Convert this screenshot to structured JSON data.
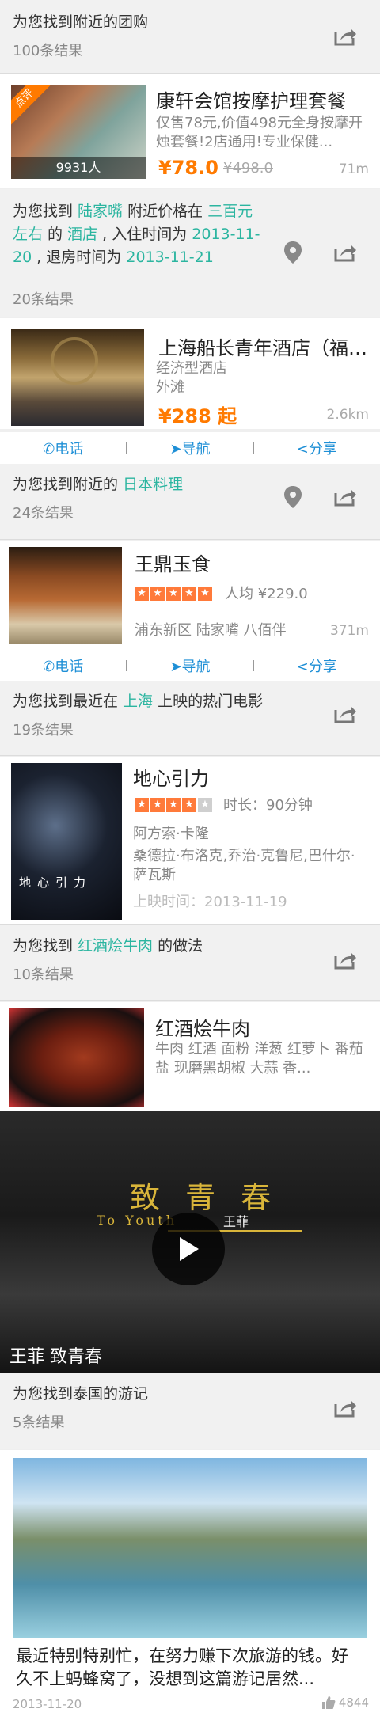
{
  "groupon_header": {
    "title": "为您找到附近的团购",
    "count": "100条结果"
  },
  "groupon_item": {
    "badge": "点评",
    "title": "康轩会馆按摩护理套餐",
    "desc": "仅售78元,价值498元全身按摩开烛套餐!2店通用!专业保健...",
    "price": "¥78.0",
    "old_price": "¥498.0",
    "distance": "71m",
    "people": "9931人"
  },
  "hotel_header": {
    "t1": "为您找到 ",
    "loc": "陆家嘴",
    "t2": " 附近价格在 ",
    "range": "三百元左右",
    "t3": " 的 ",
    "type": "酒店",
    "t4": " , 入住时间为 ",
    "checkin": "2013-11-20",
    "t5": " , 退房时间为 ",
    "checkout": "2013-11-21",
    "count": "20条结果"
  },
  "hotel_item": {
    "title": "上海船长青年酒店（福州路店）",
    "category": "经济型酒店",
    "area": "外滩",
    "price": "¥288 起",
    "distance": "2.6km"
  },
  "actions": {
    "call": "电话",
    "nav": "导航",
    "share": "分享"
  },
  "food_header": {
    "t1": "为您找到附近的 ",
    "cuisine": "日本料理",
    "count": "24条结果"
  },
  "food_item": {
    "title": "王鼎玉食",
    "avg": "人均 ¥229.0",
    "address": "浦东新区 陆家嘴 八佰伴",
    "distance": "371m",
    "rating": 5
  },
  "movie_header": {
    "t1": "为您找到最近在 ",
    "city": "上海",
    "t2": " 上映的热门电影",
    "count": "19条结果"
  },
  "movie_item": {
    "title": "地心引力",
    "duration": "时长：90分钟",
    "director": "阿方索·卡隆",
    "cast": "桑德拉·布洛克,乔治·克鲁尼,巴什尔·萨瓦斯",
    "release": "上映时间：2013-11-19",
    "rating": 4
  },
  "recipe_header": {
    "t1": "为您找到 ",
    "dish": "红酒烩牛肉",
    "t2": " 的做法",
    "count": "10条结果"
  },
  "recipe_item": {
    "title": "红酒烩牛肉",
    "ingredients": "牛肉 红酒 面粉 洋葱 红萝卜 番茄 盐 现磨黑胡椒 大蒜 香..."
  },
  "video": {
    "caption": "王菲  致青春",
    "overlay_title": "致 青 春",
    "overlay_sub": "To Youth",
    "overlay_artist": "王菲"
  },
  "travel_header": {
    "title": "为您找到泰国的游记",
    "count": "5条结果"
  },
  "travel_item": {
    "desc": "最近特别特别忙，在努力赚下次旅游的钱。好久不上蚂蜂窝了，没想到这篇游记居然...",
    "date": "2013-11-20",
    "likes": "4844"
  },
  "colors": {
    "accent": "#2bb5a0",
    "price": "#ff7a00",
    "link": "#1e8fd6"
  }
}
